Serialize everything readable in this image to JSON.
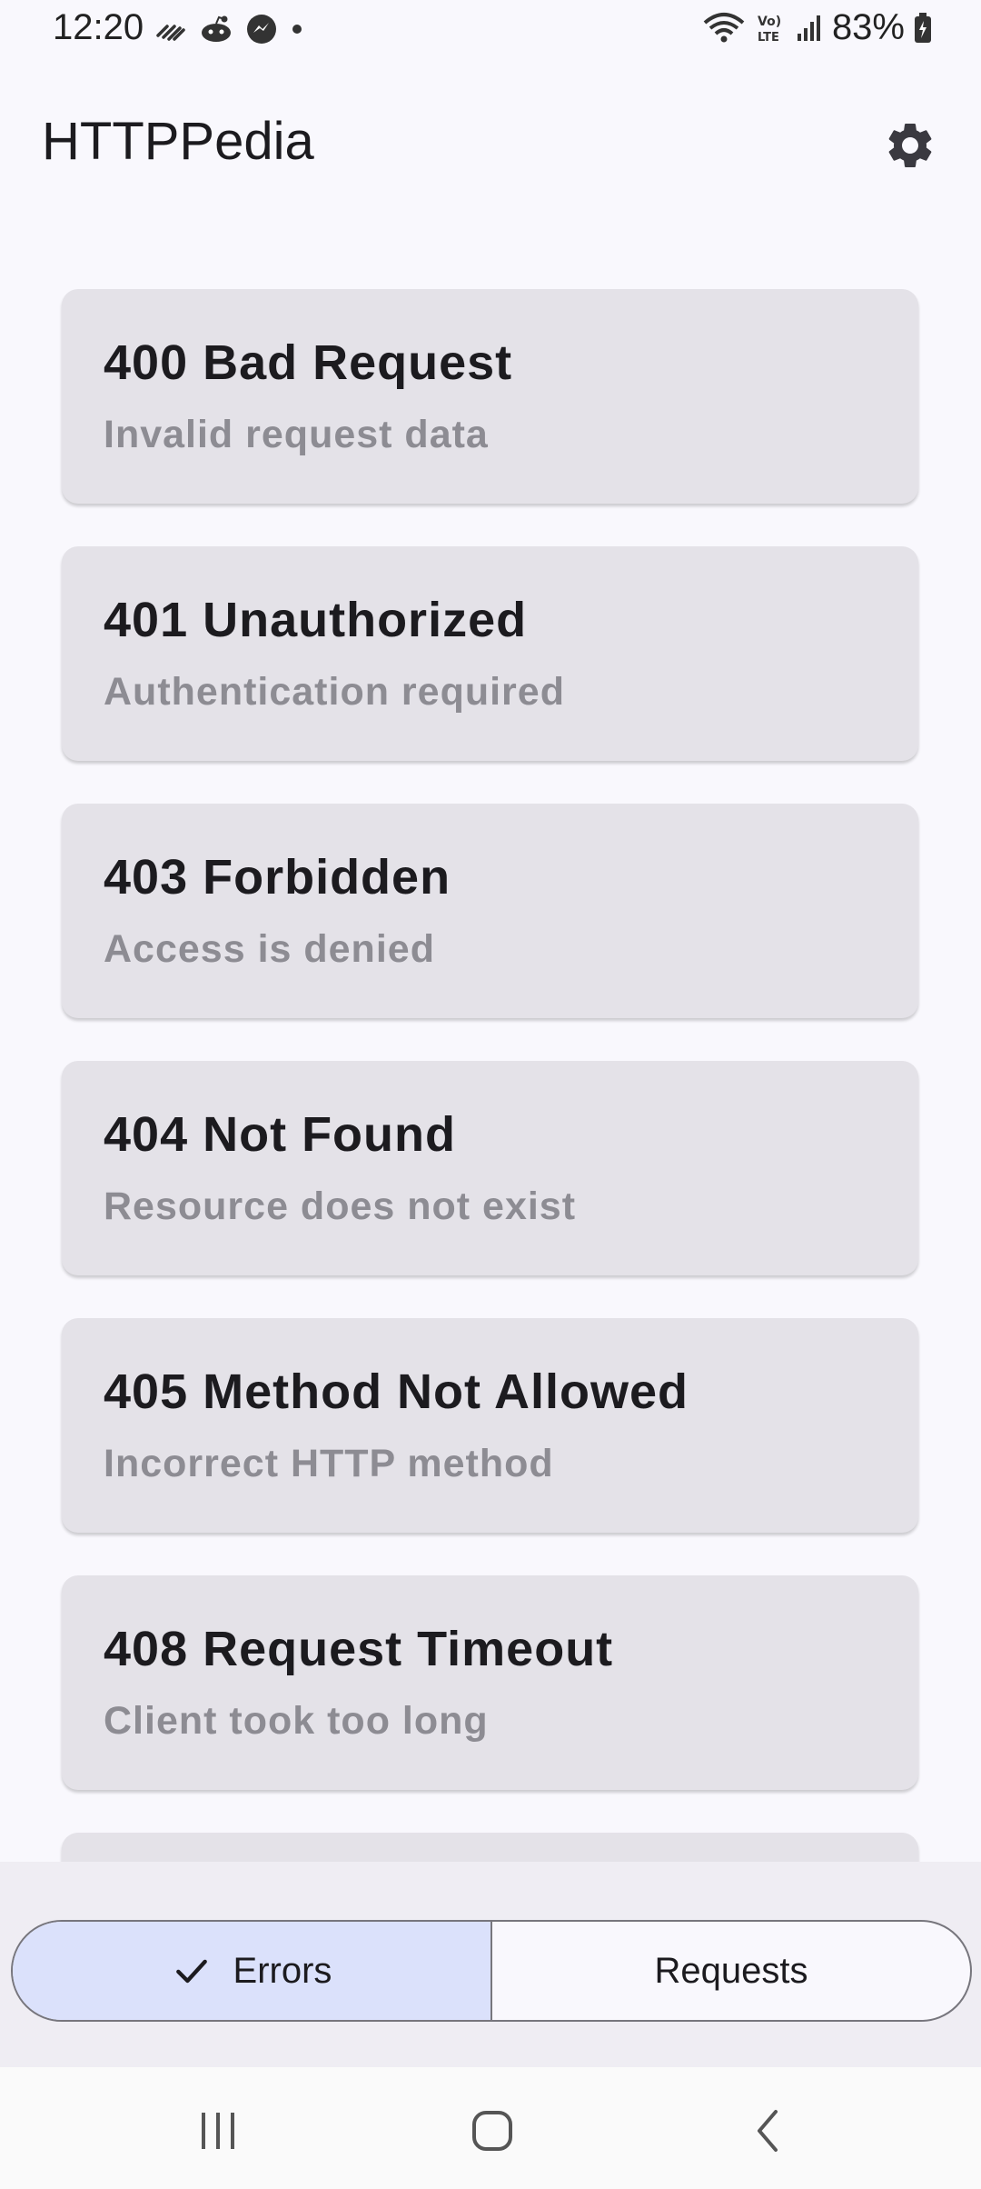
{
  "status_bar": {
    "time": "12:20",
    "battery": "83%"
  },
  "app_bar": {
    "title": "HTTPPedia",
    "settings_icon": "gear-icon"
  },
  "status_codes": [
    {
      "title": "400 Bad Request",
      "subtitle": "Invalid request data"
    },
    {
      "title": "401 Unauthorized",
      "subtitle": "Authentication required"
    },
    {
      "title": "403 Forbidden",
      "subtitle": "Access is denied"
    },
    {
      "title": "404 Not Found",
      "subtitle": "Resource does not exist"
    },
    {
      "title": "405 Method Not Allowed",
      "subtitle": "Incorrect HTTP method"
    },
    {
      "title": "408 Request Timeout",
      "subtitle": "Client took too long"
    }
  ],
  "segmented": {
    "errors_label": "Errors",
    "requests_label": "Requests",
    "selected": "Errors"
  },
  "colors": {
    "background": "#f9f8fd",
    "card": "#e4e2e8",
    "selected_segment": "#dbe1fb",
    "subtitle": "#8d8c93"
  }
}
